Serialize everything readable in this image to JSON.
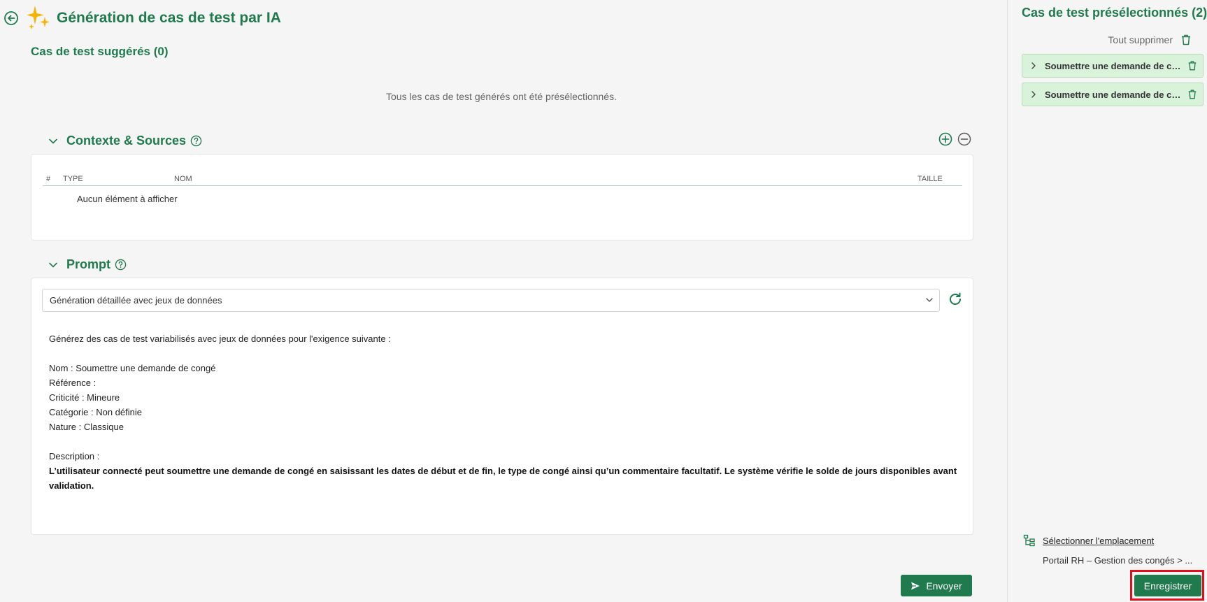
{
  "header": {
    "title": "Génération de cas de test par IA",
    "suggested_title": "Cas de test suggérés (0)",
    "empty_message": "Tous les cas de test générés ont été présélectionnés."
  },
  "context": {
    "title": "Contexte & Sources",
    "columns": {
      "num": "#",
      "type": "TYPE",
      "name": "NOM",
      "size": "TAILLE"
    },
    "empty": "Aucun élément à afficher"
  },
  "prompt": {
    "title": "Prompt",
    "selected_template": "Génération détaillée avec jeux de données",
    "intro": "Générez des cas de test variabilisés avec jeux de données pour l'exigence suivante :",
    "fields": [
      "Nom : Soumettre une demande de congé",
      "Référence :",
      "Criticité : Mineure",
      "Catégorie : Non définie",
      "Nature : Classique"
    ],
    "description_label": "Description :",
    "description": "L’utilisateur connecté peut soumettre une demande de congé en saisissant les dates de début et de fin, le type de congé ainsi qu’un commentaire facultatif. Le système vérifie le solde de jours disponibles avant validation.",
    "send_label": "Envoyer"
  },
  "preselected": {
    "title": "Cas de test présélectionnés (2)",
    "clear_all": "Tout supprimer",
    "items": [
      {
        "label": "Soumettre une demande de congé"
      },
      {
        "label": "Soumettre une demande de congé"
      }
    ],
    "select_location": "Sélectionner l'emplacement",
    "location_path": "Portail RH – Gestion des congés > ...",
    "save_label": "Enregistrer"
  },
  "colors": {
    "accent": "#1f7a4d",
    "item_bg": "#d9f2da",
    "highlight": "#e0101a",
    "sparkle": "#f5b301"
  }
}
